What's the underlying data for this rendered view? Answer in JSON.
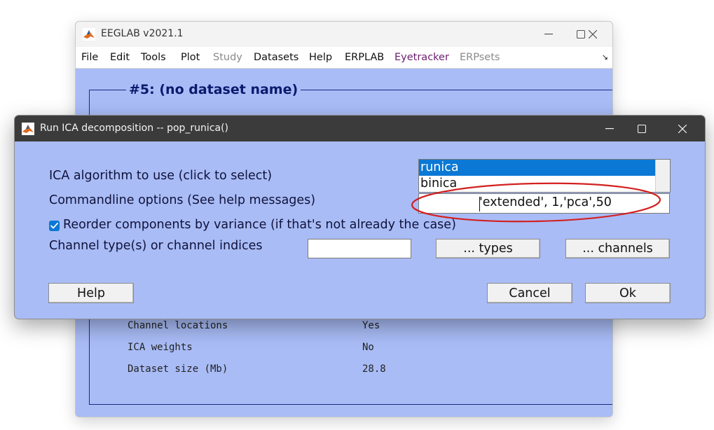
{
  "main_window": {
    "title": "EEGLAB v2021.1",
    "menu": [
      "File",
      "Edit",
      "Tools",
      "Plot",
      "Study",
      "Datasets",
      "Help",
      "ERPLAB",
      "Eyetracker",
      "ERPsets"
    ],
    "dataset_title": "#5: (no dataset name)",
    "info_rows": [
      {
        "label": "Channel locations",
        "value": "Yes"
      },
      {
        "label": "ICA weights",
        "value": "No"
      },
      {
        "label": "Dataset size (Mb)",
        "value": "28.8"
      }
    ]
  },
  "dialog": {
    "title": "Run ICA decomposition -- pop_runica()",
    "algorithm_label": "ICA algorithm to use (click to select)",
    "algorithms": [
      "runica",
      "binica"
    ],
    "selected_algorithm": "runica",
    "options_label": "Commandline options (See help messages)",
    "options_value": "'extended', 1,'pca',50",
    "reorder_label": "Reorder components by variance (if that's not already the case)",
    "reorder_checked": true,
    "channel_label": "Channel type(s) or channel indices",
    "channel_value": "",
    "types_button": "... types",
    "channels_button": "... channels",
    "help_button": "Help",
    "cancel_button": "Cancel",
    "ok_button": "Ok"
  },
  "colors": {
    "eeglab_blue": "#a9bcf6",
    "selection_blue": "#0a78d4",
    "annotation_red": "#d42020",
    "dialog_titlebar": "#3b3b3b"
  },
  "icons": {
    "app": "matlab-icon",
    "minimize": "minimize-icon",
    "maximize": "maximize-icon",
    "close": "close-icon",
    "checkbox": "checkmark-icon"
  }
}
